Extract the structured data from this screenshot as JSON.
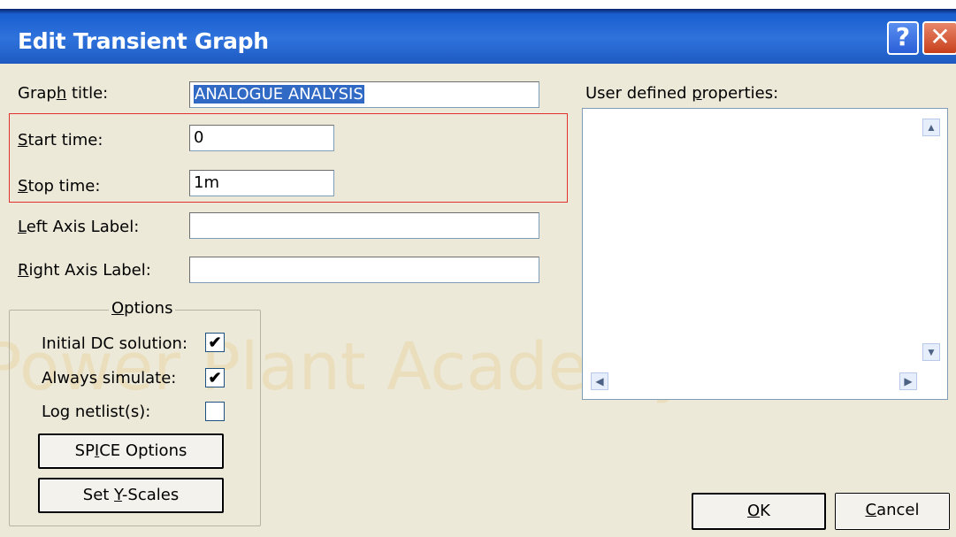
{
  "window": {
    "title": "Edit Transient Graph",
    "help_glyph": "?",
    "close_glyph": "✕"
  },
  "fields": {
    "graph_title": {
      "label_pre": "Grap",
      "label_u": "h",
      "label_post": " title:",
      "value": "ANALOGUE ANALYSIS"
    },
    "start_time": {
      "label_u": "S",
      "label_post": "tart time:",
      "value": "0"
    },
    "stop_time": {
      "label_u": "S",
      "label_post": "top time:",
      "value": "1m"
    },
    "left_axis": {
      "label_u": "L",
      "label_post": "eft Axis Label:",
      "value": ""
    },
    "right_axis": {
      "label_u": "R",
      "label_post": "ight Axis Label:",
      "value": ""
    }
  },
  "user_props": {
    "label_pre": "User defined ",
    "label_u": "p",
    "label_post": "roperties:"
  },
  "options": {
    "title_u": "O",
    "title_post": "ptions",
    "initial_dc": {
      "label": "Initial DC solution:",
      "checked": "✔"
    },
    "always_sim": {
      "label": "Always simulate:",
      "checked": "✔"
    },
    "log_netlist": {
      "label": "Log netlist(s):",
      "checked": ""
    }
  },
  "buttons": {
    "spice": {
      "pre": "SP",
      "u": "I",
      "post": "CE Options"
    },
    "yscales": {
      "pre": "Set ",
      "u": "Y",
      "post": "-Scales"
    },
    "ok": {
      "u": "O",
      "post": "K"
    },
    "cancel": {
      "u": "C",
      "post": "ancel"
    }
  },
  "scroll": {
    "up": "▲",
    "down": "▼",
    "left": "◀",
    "right": "▶"
  },
  "watermark": "Power Plant Academy"
}
